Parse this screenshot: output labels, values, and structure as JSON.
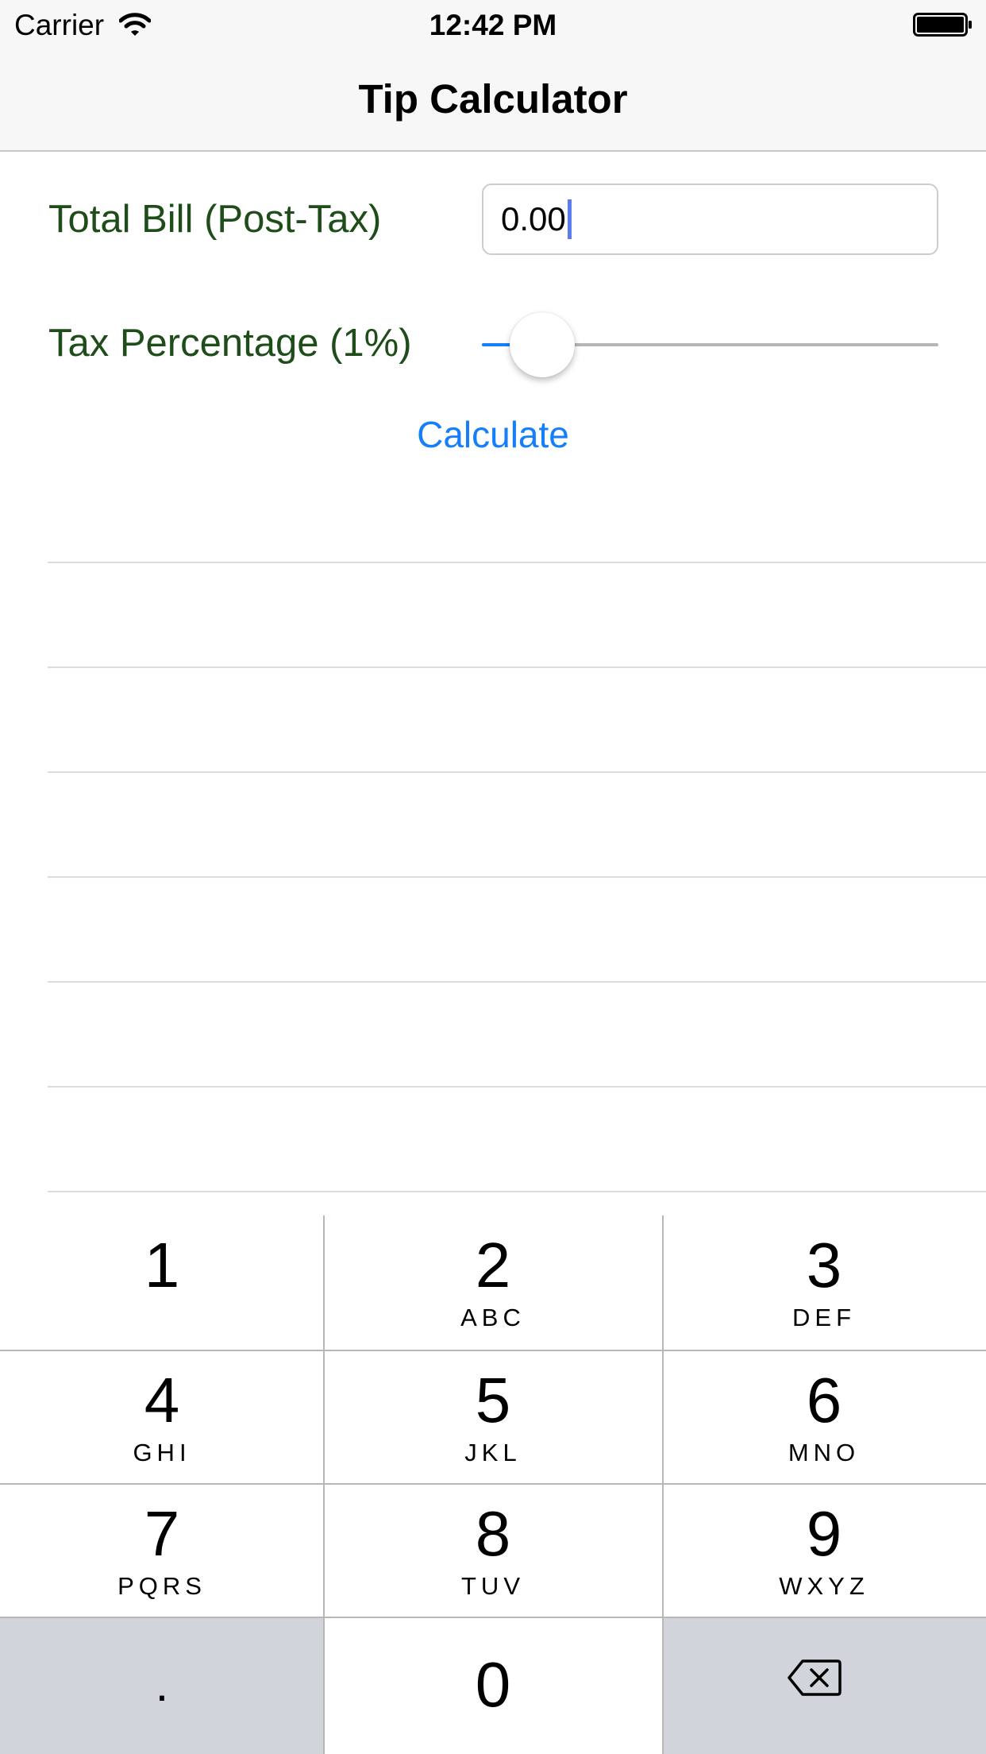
{
  "status_bar": {
    "carrier": "Carrier",
    "time": "12:42 PM",
    "wifi_icon": "wifi-icon",
    "battery_icon": "battery-icon"
  },
  "nav": {
    "title": "Tip Calculator"
  },
  "form": {
    "bill_label": "Total Bill (Post-Tax)",
    "bill_value": "0.00",
    "tax_label": "Tax Percentage (1%)",
    "tax_slider_fraction": 0.05,
    "calculate_label": "Calculate"
  },
  "colors": {
    "label_green": "#1e4d1a",
    "accent_blue": "#147efb",
    "keypad_gray": "#d1d5db"
  },
  "keypad": {
    "keys": [
      {
        "digit": "1",
        "letters": ""
      },
      {
        "digit": "2",
        "letters": "ABC"
      },
      {
        "digit": "3",
        "letters": "DEF"
      },
      {
        "digit": "4",
        "letters": "GHI"
      },
      {
        "digit": "5",
        "letters": "JKL"
      },
      {
        "digit": "6",
        "letters": "MNO"
      },
      {
        "digit": "7",
        "letters": "PQRS"
      },
      {
        "digit": "8",
        "letters": "TUV"
      },
      {
        "digit": "9",
        "letters": "WXYZ"
      }
    ],
    "decimal": ".",
    "zero": "0",
    "delete_icon": "backspace-icon"
  }
}
